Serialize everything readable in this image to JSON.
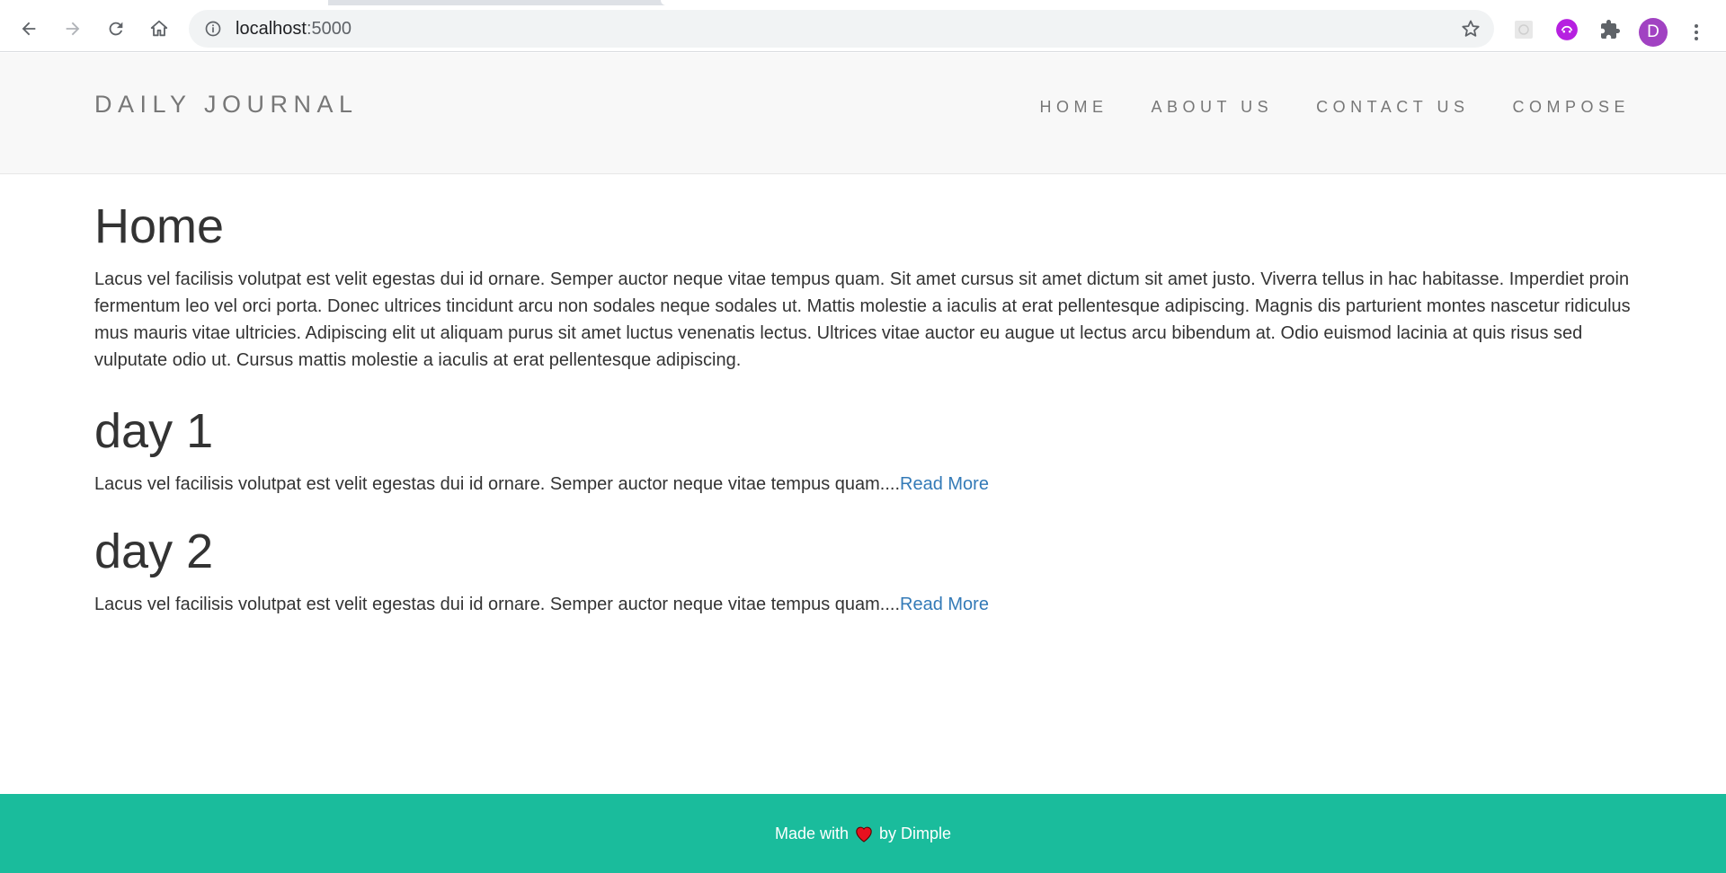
{
  "browser": {
    "url_host": "localhost",
    "url_port": ":5000",
    "profile_initial": "D",
    "icons": [
      "back-icon",
      "forward-icon",
      "reload-icon",
      "home-icon",
      "info-icon",
      "star-icon",
      "extension-icon",
      "puzzle-icon",
      "kebab-menu-icon"
    ]
  },
  "nav": {
    "brand": "DAILY JOURNAL",
    "items": [
      {
        "label": "HOME"
      },
      {
        "label": "ABOUT US"
      },
      {
        "label": "CONTACT US"
      },
      {
        "label": "COMPOSE"
      }
    ]
  },
  "main": {
    "title": "Home",
    "intro": "Lacus vel facilisis volutpat est velit egestas dui id ornare. Semper auctor neque vitae tempus quam. Sit amet cursus sit amet dictum sit amet justo. Viverra tellus in hac habitasse. Imperdiet proin fermentum leo vel orci porta. Donec ultrices tincidunt arcu non sodales neque sodales ut. Mattis molestie a iaculis at erat pellentesque adipiscing. Magnis dis parturient montes nascetur ridiculus mus mauris vitae ultricies. Adipiscing elit ut aliquam purus sit amet luctus venenatis lectus. Ultrices vitae auctor eu augue ut lectus arcu bibendum at. Odio euismod lacinia at quis risus sed vulputate odio ut. Cursus mattis molestie a iaculis at erat pellentesque adipiscing.",
    "posts": [
      {
        "title": "day 1",
        "excerpt": "Lacus vel facilisis volutpat est velit egestas dui id ornare. Semper auctor neque vitae tempus quam....",
        "link": "Read More"
      },
      {
        "title": "day 2",
        "excerpt": "Lacus vel facilisis volutpat est velit egestas dui id ornare. Semper auctor neque vitae tempus quam....",
        "link": "Read More"
      }
    ]
  },
  "footer": {
    "prefix": "Made with",
    "suffix": "by Dimple"
  },
  "colors": {
    "footer_bg": "#1abc9c",
    "link": "#337ab7",
    "nav_bg": "#f8f8f8",
    "avatar": "#a142c2",
    "heart": "#e8111f"
  }
}
